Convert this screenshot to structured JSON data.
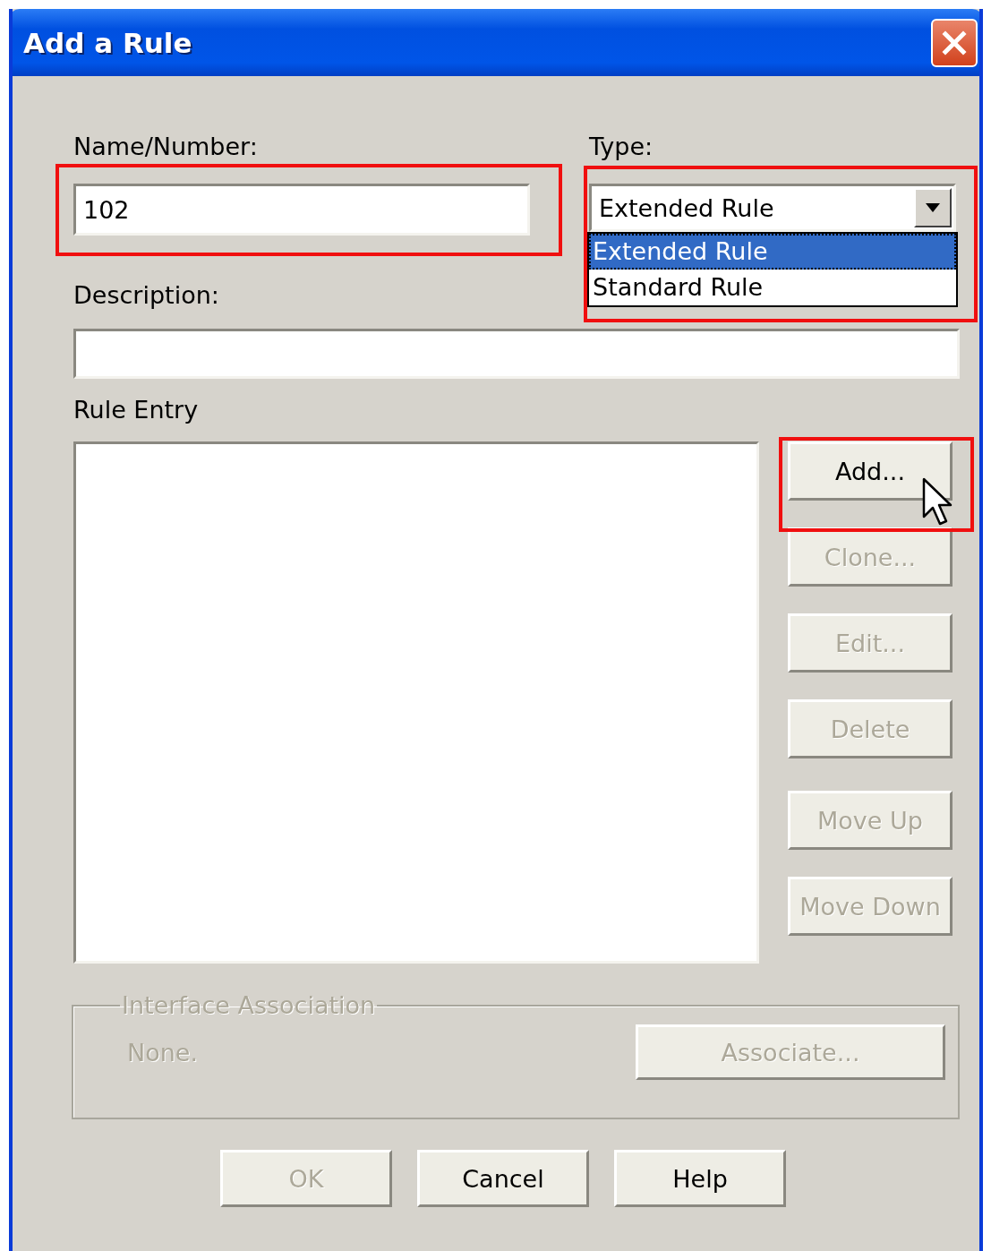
{
  "window": {
    "title": "Add a Rule"
  },
  "name_field": {
    "label": "Name/Number:",
    "value": "102",
    "highlighted": true
  },
  "type_field": {
    "label": "Type:",
    "value": "Extended Rule",
    "expanded": true,
    "highlighted": true,
    "options": [
      {
        "label": "Extended Rule",
        "selected": true
      },
      {
        "label": "Standard Rule",
        "selected": false
      }
    ]
  },
  "description_field": {
    "label": "Description:"
  },
  "rule_entry": {
    "label": "Rule Entry"
  },
  "entry_buttons": [
    {
      "label": "Add...",
      "disabled": false,
      "highlighted": true,
      "hovered": true
    },
    {
      "label": "Clone...",
      "disabled": true,
      "highlighted": false,
      "hovered": false
    },
    {
      "label": "Edit...",
      "disabled": true,
      "highlighted": false,
      "hovered": false
    },
    {
      "label": "Delete",
      "disabled": true,
      "highlighted": false,
      "hovered": false
    }
  ],
  "order_buttons": [
    {
      "label": "Move Up",
      "disabled": true
    },
    {
      "label": "Move Down",
      "disabled": true
    }
  ],
  "interface_association": {
    "title": "Interface Association",
    "value": "None.",
    "disabled": true,
    "button": {
      "label": "Associate...",
      "disabled": true
    }
  },
  "footer_buttons": [
    {
      "label": "OK",
      "disabled": true
    },
    {
      "label": "Cancel",
      "disabled": false
    },
    {
      "label": "Help",
      "disabled": false
    }
  ]
}
